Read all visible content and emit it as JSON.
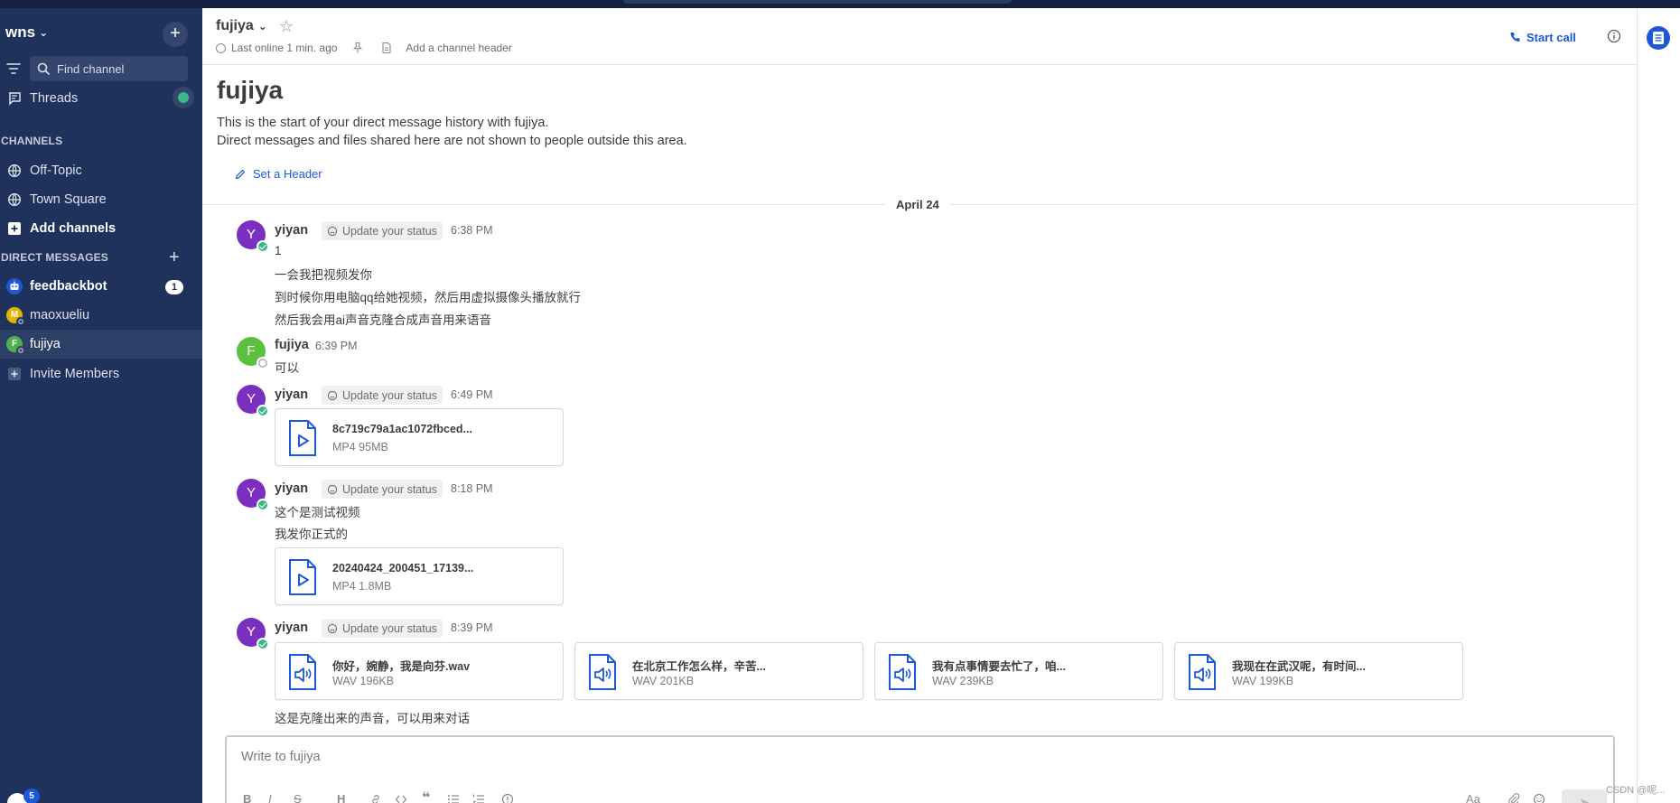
{
  "team": {
    "name": "wns"
  },
  "sidebar": {
    "find_placeholder": "Find channel",
    "threads_label": "Threads",
    "channels_heading": "CHANNELS",
    "channels": [
      {
        "label": "Off-Topic",
        "icon": "globe-icon"
      },
      {
        "label": "Town Square",
        "icon": "globe-icon"
      }
    ],
    "add_channels_label": "Add channels",
    "dm_heading": "DIRECT MESSAGES",
    "dms": [
      {
        "label": "feedbackbot",
        "badge": "1",
        "avatar_color": "#1c58d9"
      },
      {
        "label": "maoxueliu",
        "avatar_initial": "M",
        "avatar_color": "#e0b400"
      },
      {
        "label": "fujiya",
        "avatar_initial": "F",
        "avatar_color": "#4fb04f"
      }
    ],
    "invite_label": "Invite Members",
    "bottom_badge": "5"
  },
  "header": {
    "channel_name": "fujiya",
    "last_online": "Last online 1 min. ago",
    "add_header": "Add a channel header",
    "start_call": "Start call"
  },
  "intro": {
    "title": "fujiya",
    "line1": "This is the start of your direct message history with fujiya.",
    "line2": "Direct messages and files shared here are not shown to people outside this area.",
    "set_header": "Set a Header"
  },
  "date_separator": "April 24",
  "status_pill": "Update your status",
  "posts": {
    "p1": {
      "user": "yiyan",
      "initial": "Y",
      "time": "6:38 PM",
      "lines": [
        "1",
        "一会我把视频发你",
        "到时候你用电脑qq给她视频，然后用虚拟摄像头播放就行",
        "然后我会用ai声音克隆合成声音用来语音"
      ]
    },
    "p2": {
      "user": "fujiya",
      "initial": "F",
      "time": "6:39 PM",
      "lines": [
        "可以"
      ]
    },
    "p3": {
      "user": "yiyan",
      "initial": "Y",
      "time": "6:49 PM",
      "file": {
        "name": "8c719c79a1ac1072fbced...",
        "meta": "MP4 95MB"
      }
    },
    "p4": {
      "user": "yiyan",
      "initial": "Y",
      "time": "8:18 PM",
      "lines": [
        "这个是测试视频",
        "我发你正式的"
      ],
      "file": {
        "name": "20240424_200451_17139...",
        "meta": "MP4 1.8MB"
      }
    },
    "p5": {
      "user": "yiyan",
      "initial": "Y",
      "time": "8:39 PM",
      "files": [
        {
          "name": "你好，婉静，我是向芬.wav",
          "meta": "WAV 196KB"
        },
        {
          "name": "在北京工作怎么样，辛苦...",
          "meta": "WAV 201KB"
        },
        {
          "name": "我有点事情要去忙了，咱...",
          "meta": "WAV 239KB"
        },
        {
          "name": "我现在在武汉呢，有时间...",
          "meta": "WAV 199KB"
        }
      ],
      "caption": "这是克隆出来的声音，可以用来对话"
    }
  },
  "composer": {
    "placeholder": "Write to fujiya",
    "format_buttons": [
      "B",
      "I",
      "S",
      "H"
    ],
    "text_size": "Aa"
  },
  "watermark": "CSDN @呢...",
  "colors": {
    "sidebar_bg": "#1e325c",
    "accent": "#1c58d9",
    "online": "#3db887",
    "yiyan_avatar": "#7b2fbe",
    "fujiya_avatar": "#5bbf3f"
  }
}
